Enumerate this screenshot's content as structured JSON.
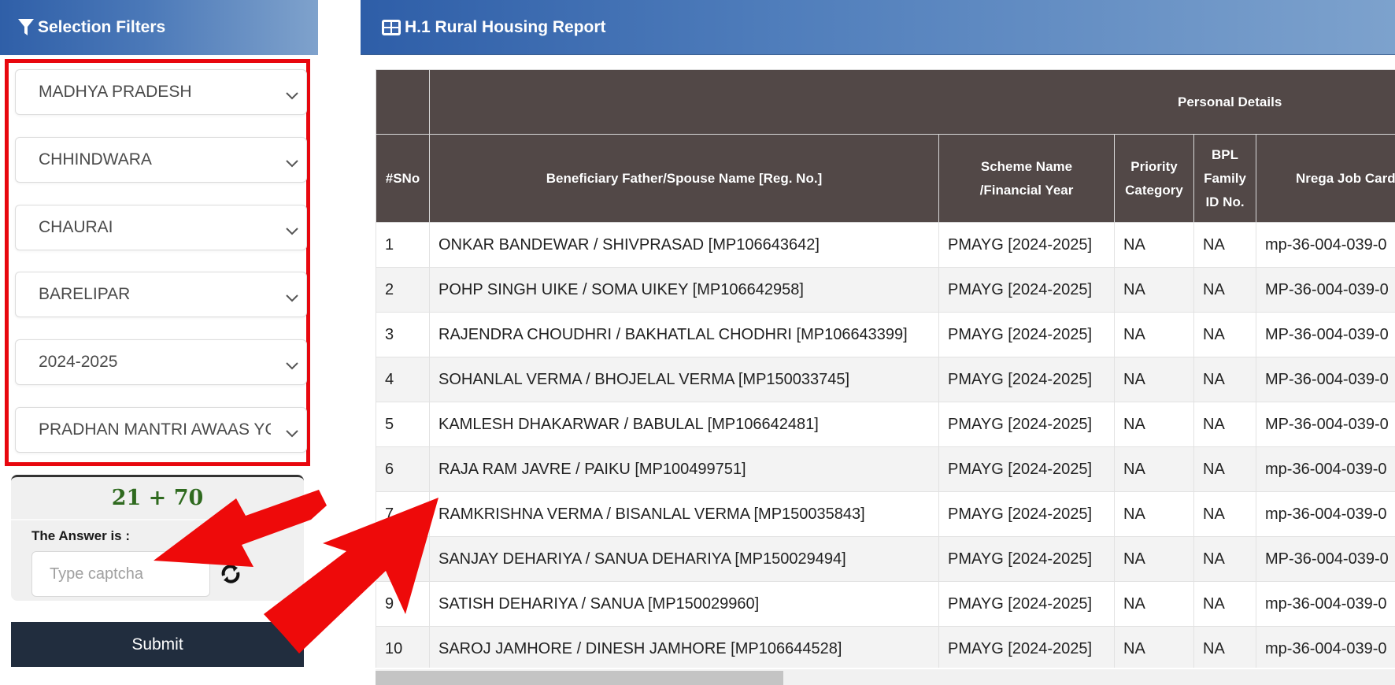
{
  "left_panel": {
    "title": "Selection Filters",
    "icon": "filter-icon",
    "filters": [
      {
        "name": "state",
        "value": "MADHYA PRADESH"
      },
      {
        "name": "district",
        "value": "CHHINDWARA"
      },
      {
        "name": "block",
        "value": "CHAURAI"
      },
      {
        "name": "village",
        "value": "BARELIPAR"
      },
      {
        "name": "financial-year",
        "value": "2024-2025"
      },
      {
        "name": "scheme",
        "value": "PRADHAN MANTRI AWAAS YOJANA"
      }
    ],
    "captcha": {
      "equation": "21 + 70",
      "answer_label": "The Answer is :",
      "input_value": "",
      "input_placeholder": "Type captcha",
      "refresh_icon": "refresh-icon"
    },
    "submit_label": "Submit"
  },
  "main_panel": {
    "title": "H.1 Rural Housing Report",
    "icon": "table-icon",
    "table": {
      "group_header": "Personal Details",
      "columns": [
        "#SNo",
        "Beneficiary Father/Spouse Name [Reg. No.]",
        "Scheme Name /Financial Year",
        "Priority Category",
        "BPL Family ID No.",
        "Nrega Job Card"
      ],
      "rows": [
        {
          "sno": "1",
          "name": "ONKAR BANDEWAR / SHIVPRASAD [MP106643642]",
          "scheme": "PMAYG [2024-2025]",
          "priority": "NA",
          "bpl": "NA",
          "nrega": "mp-36-004-039-0"
        },
        {
          "sno": "2",
          "name": "POHP SINGH UIKE / SOMA UIKEY [MP106642958]",
          "scheme": "PMAYG [2024-2025]",
          "priority": "NA",
          "bpl": "NA",
          "nrega": "MP-36-004-039-0"
        },
        {
          "sno": "3",
          "name": "RAJENDRA CHOUDHRI / BAKHATLAL CHODHRI [MP106643399]",
          "scheme": "PMAYG [2024-2025]",
          "priority": "NA",
          "bpl": "NA",
          "nrega": "MP-36-004-039-0"
        },
        {
          "sno": "4",
          "name": "SOHANLAL VERMA / BHOJELAL VERMA [MP150033745]",
          "scheme": "PMAYG [2024-2025]",
          "priority": "NA",
          "bpl": "NA",
          "nrega": "MP-36-004-039-0"
        },
        {
          "sno": "5",
          "name": "KAMLESH DHAKARWAR / BABULAL [MP106642481]",
          "scheme": "PMAYG [2024-2025]",
          "priority": "NA",
          "bpl": "NA",
          "nrega": "MP-36-004-039-0"
        },
        {
          "sno": "6",
          "name": "RAJA RAM JAVRE / PAIKU [MP100499751]",
          "scheme": "PMAYG [2024-2025]",
          "priority": "NA",
          "bpl": "NA",
          "nrega": "mp-36-004-039-0"
        },
        {
          "sno": "7",
          "name": "RAMKRISHNA VERMA / BISANLAL VERMA [MP150035843]",
          "scheme": "PMAYG [2024-2025]",
          "priority": "NA",
          "bpl": "NA",
          "nrega": "mp-36-004-039-0"
        },
        {
          "sno": "8",
          "name": "SANJAY DEHARIYA / SANUA DEHARIYA [MP150029494]",
          "scheme": "PMAYG [2024-2025]",
          "priority": "NA",
          "bpl": "NA",
          "nrega": "MP-36-004-039-0"
        },
        {
          "sno": "9",
          "name": "SATISH DEHARIYA / SANUA [MP150029960]",
          "scheme": "PMAYG [2024-2025]",
          "priority": "NA",
          "bpl": "NA",
          "nrega": "mp-36-004-039-0"
        },
        {
          "sno": "10",
          "name": "SAROJ JAMHORE / DINESH JAMHORE [MP106644528]",
          "scheme": "PMAYG [2024-2025]",
          "priority": "NA",
          "bpl": "NA",
          "nrega": "mp-36-004-039-0"
        }
      ]
    },
    "horizontal_scroll_fraction": 0.4
  },
  "annotations": {
    "arrow_color": "#ee0a0a",
    "highlight_color": "#e8070e"
  }
}
